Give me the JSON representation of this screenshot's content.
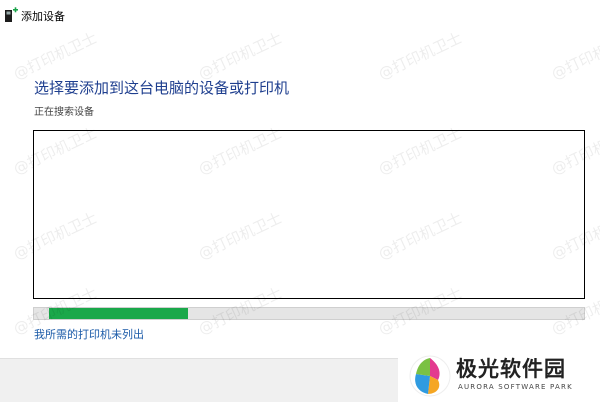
{
  "window": {
    "title": "添加设备"
  },
  "main": {
    "heading": "选择要添加到这台电脑的设备或打印机",
    "status": "正在搜索设备",
    "progress": 0.26,
    "link": "我所需的打印机未列出"
  },
  "watermark": {
    "text": "@打印机卫士"
  },
  "brand": {
    "name_cn": "极光软件园",
    "name_en": "AURORA SOFTWARE PARK"
  },
  "colors": {
    "heading": "#1f3f8f",
    "link": "#1a5aa8",
    "progress": "#1aa84a"
  }
}
